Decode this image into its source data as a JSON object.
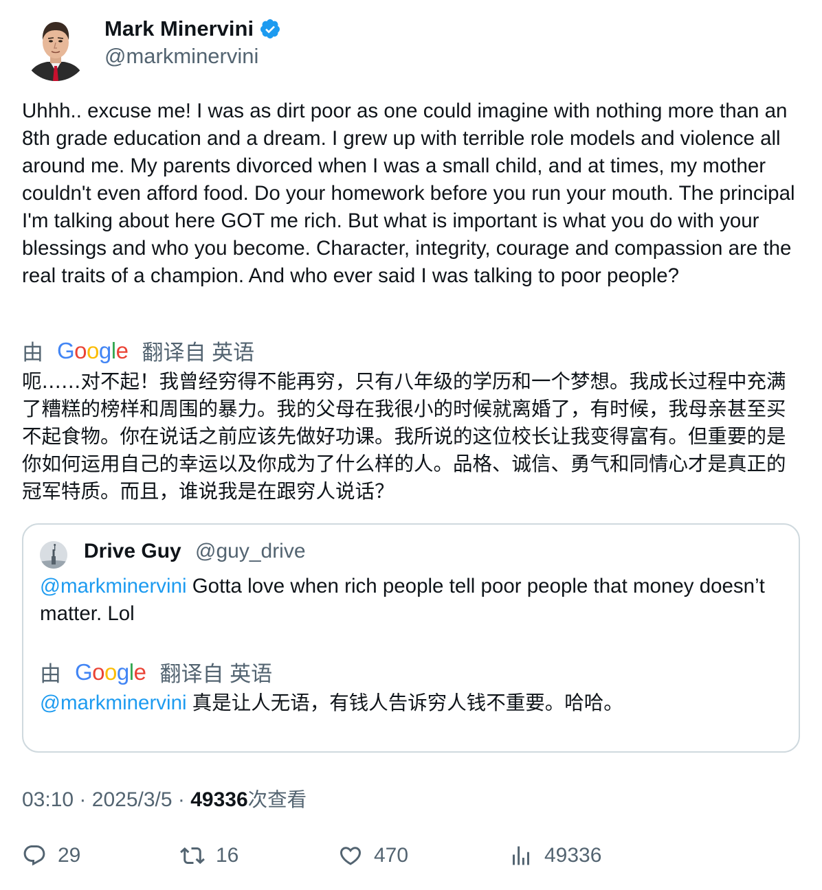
{
  "author": {
    "name": "Mark Minervini",
    "handle": "@markminervini",
    "verified": true
  },
  "tweet": {
    "text": "Uhhh.. excuse me!  I was as dirt poor as one could imagine with nothing more than an 8th grade education and a dream. I grew up with terrible role models and violence all around me. My parents divorced when I was a small child, and at times, my mother couldn't even afford food.  Do your homework before you run your mouth. The principal I'm talking about here GOT me rich. But what is important is what you do with your blessings and who you become. Character, integrity, courage and compassion are the real traits of a champion.  And who ever said I was talking to poor people?",
    "translation_prefix": "由",
    "translation_provider": "Google",
    "translation_suffix": "翻译自 英语",
    "translated_text": "呃……对不起！我曾经穷得不能再穷，只有八年级的学历和一个梦想。我成长过程中充满了糟糕的榜样和周围的暴力。我的父母在我很小的时候就离婚了，有时候，我母亲甚至买不起食物。你在说话之前应该先做好功课。我所说的这位校长让我变得富有。但重要的是你如何运用自己的幸运以及你成为了什么样的人。品格、诚信、勇气和同情心才是真正的冠军特质。而且，谁说我是在跟穷人说话？"
  },
  "quoted": {
    "name": "Drive Guy",
    "handle": "@guy_drive",
    "mention": "@markminervini",
    "text": "Gotta love when rich people tell poor people that money doesn’t matter. Lol",
    "translation_prefix": "由",
    "translation_provider": "Google",
    "translation_suffix": "翻译自 英语",
    "translated_mention": "@markminervini",
    "translated_text": "真是让人无语，有钱人告诉穷人钱不重要。哈哈。"
  },
  "meta": {
    "time": "03:10",
    "separator": "·",
    "date": "2025/3/5",
    "views": "49336",
    "views_label": "次查看"
  },
  "actions": {
    "replies": "29",
    "retweets": "16",
    "likes": "470",
    "views": "49336"
  },
  "icons": {
    "verified": "verified-badge-icon",
    "reply": "reply-icon",
    "retweet": "retweet-icon",
    "like": "heart-icon",
    "views": "bar-chart-icon"
  },
  "colors": {
    "accent": "#1d9bf0",
    "secondary_text": "#536471",
    "border": "#cfd9de",
    "google_blue": "#4285F4",
    "google_red": "#EA4335",
    "google_yellow": "#FBBC05",
    "google_green": "#34A853"
  }
}
